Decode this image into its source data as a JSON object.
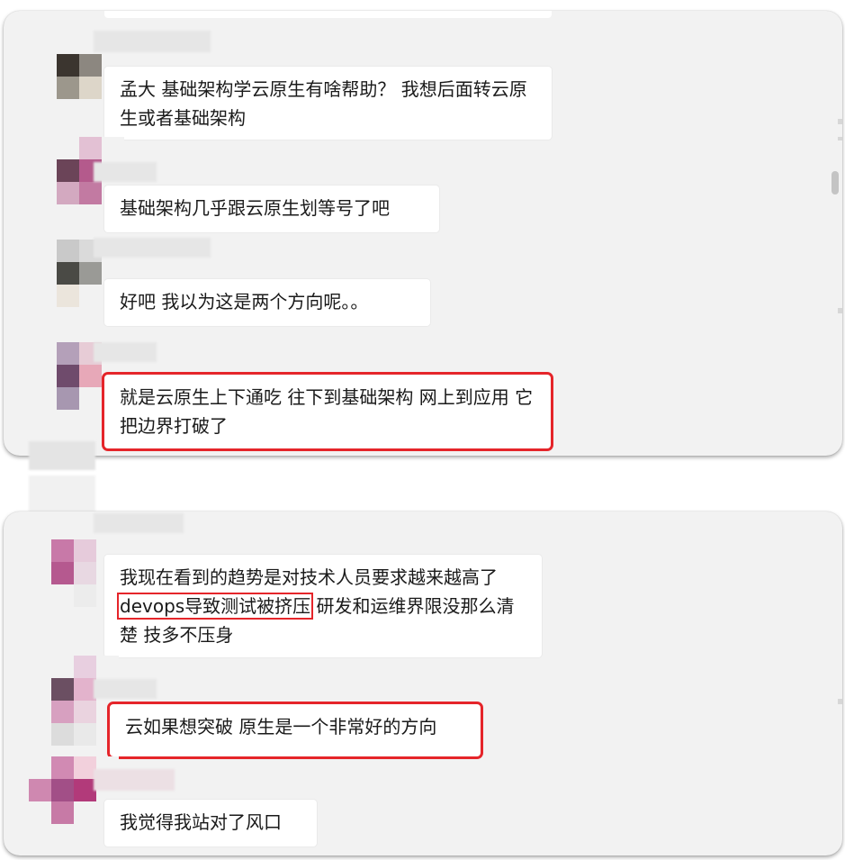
{
  "panels": [
    {
      "messages": [
        {
          "text": "孟大   基础架构学云原生有啥帮助？  我想后面转云原生或者基础架构"
        },
        {
          "text": "基础架构几乎跟云原生划等号了吧"
        },
        {
          "text": "好吧  我以为这是两个方向呢。。"
        },
        {
          "text": "就是云原生上下通吃 往下到基础架构 网上到应用 它把边界打破了",
          "highlighted": true
        }
      ]
    },
    {
      "messages": [
        {
          "text_before": "我现在看到的趋势是对技术人员要求越来越高了",
          "text_highlight": "devops导致测试被挤压",
          "text_after": " 研发和运维界限没那么清楚 技多不压身"
        },
        {
          "text": "云如果想突破 原生是一个非常好的方向",
          "highlighted": true
        },
        {
          "text": "我觉得我站对了风口"
        }
      ]
    }
  ],
  "colors": {
    "panel_background": "#f2f2f2",
    "bubble_background": "#ffffff",
    "highlight_border": "#e5252a",
    "text": "#1a1a1a"
  },
  "icons": {
    "avatar": "pixelated-avatar",
    "scrollbar": "scroll-thumb"
  }
}
